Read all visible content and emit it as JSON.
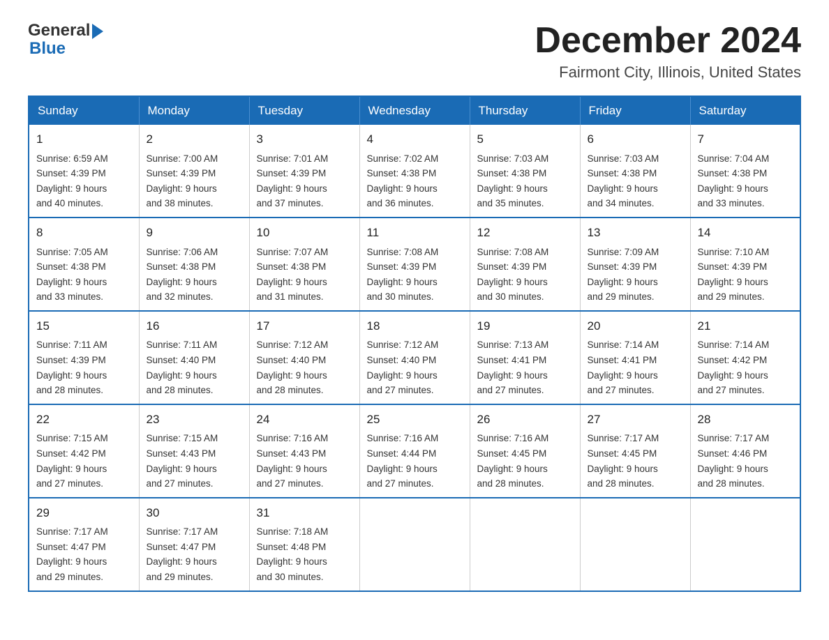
{
  "header": {
    "logo_general": "General",
    "logo_blue": "Blue",
    "month_title": "December 2024",
    "location": "Fairmont City, Illinois, United States"
  },
  "weekdays": [
    "Sunday",
    "Monday",
    "Tuesday",
    "Wednesday",
    "Thursday",
    "Friday",
    "Saturday"
  ],
  "weeks": [
    [
      {
        "day": "1",
        "sunrise": "6:59 AM",
        "sunset": "4:39 PM",
        "daylight": "9 hours and 40 minutes."
      },
      {
        "day": "2",
        "sunrise": "7:00 AM",
        "sunset": "4:39 PM",
        "daylight": "9 hours and 38 minutes."
      },
      {
        "day": "3",
        "sunrise": "7:01 AM",
        "sunset": "4:39 PM",
        "daylight": "9 hours and 37 minutes."
      },
      {
        "day": "4",
        "sunrise": "7:02 AM",
        "sunset": "4:38 PM",
        "daylight": "9 hours and 36 minutes."
      },
      {
        "day": "5",
        "sunrise": "7:03 AM",
        "sunset": "4:38 PM",
        "daylight": "9 hours and 35 minutes."
      },
      {
        "day": "6",
        "sunrise": "7:03 AM",
        "sunset": "4:38 PM",
        "daylight": "9 hours and 34 minutes."
      },
      {
        "day": "7",
        "sunrise": "7:04 AM",
        "sunset": "4:38 PM",
        "daylight": "9 hours and 33 minutes."
      }
    ],
    [
      {
        "day": "8",
        "sunrise": "7:05 AM",
        "sunset": "4:38 PM",
        "daylight": "9 hours and 33 minutes."
      },
      {
        "day": "9",
        "sunrise": "7:06 AM",
        "sunset": "4:38 PM",
        "daylight": "9 hours and 32 minutes."
      },
      {
        "day": "10",
        "sunrise": "7:07 AM",
        "sunset": "4:38 PM",
        "daylight": "9 hours and 31 minutes."
      },
      {
        "day": "11",
        "sunrise": "7:08 AM",
        "sunset": "4:39 PM",
        "daylight": "9 hours and 30 minutes."
      },
      {
        "day": "12",
        "sunrise": "7:08 AM",
        "sunset": "4:39 PM",
        "daylight": "9 hours and 30 minutes."
      },
      {
        "day": "13",
        "sunrise": "7:09 AM",
        "sunset": "4:39 PM",
        "daylight": "9 hours and 29 minutes."
      },
      {
        "day": "14",
        "sunrise": "7:10 AM",
        "sunset": "4:39 PM",
        "daylight": "9 hours and 29 minutes."
      }
    ],
    [
      {
        "day": "15",
        "sunrise": "7:11 AM",
        "sunset": "4:39 PM",
        "daylight": "9 hours and 28 minutes."
      },
      {
        "day": "16",
        "sunrise": "7:11 AM",
        "sunset": "4:40 PM",
        "daylight": "9 hours and 28 minutes."
      },
      {
        "day": "17",
        "sunrise": "7:12 AM",
        "sunset": "4:40 PM",
        "daylight": "9 hours and 28 minutes."
      },
      {
        "day": "18",
        "sunrise": "7:12 AM",
        "sunset": "4:40 PM",
        "daylight": "9 hours and 27 minutes."
      },
      {
        "day": "19",
        "sunrise": "7:13 AM",
        "sunset": "4:41 PM",
        "daylight": "9 hours and 27 minutes."
      },
      {
        "day": "20",
        "sunrise": "7:14 AM",
        "sunset": "4:41 PM",
        "daylight": "9 hours and 27 minutes."
      },
      {
        "day": "21",
        "sunrise": "7:14 AM",
        "sunset": "4:42 PM",
        "daylight": "9 hours and 27 minutes."
      }
    ],
    [
      {
        "day": "22",
        "sunrise": "7:15 AM",
        "sunset": "4:42 PM",
        "daylight": "9 hours and 27 minutes."
      },
      {
        "day": "23",
        "sunrise": "7:15 AM",
        "sunset": "4:43 PM",
        "daylight": "9 hours and 27 minutes."
      },
      {
        "day": "24",
        "sunrise": "7:16 AM",
        "sunset": "4:43 PM",
        "daylight": "9 hours and 27 minutes."
      },
      {
        "day": "25",
        "sunrise": "7:16 AM",
        "sunset": "4:44 PM",
        "daylight": "9 hours and 27 minutes."
      },
      {
        "day": "26",
        "sunrise": "7:16 AM",
        "sunset": "4:45 PM",
        "daylight": "9 hours and 28 minutes."
      },
      {
        "day": "27",
        "sunrise": "7:17 AM",
        "sunset": "4:45 PM",
        "daylight": "9 hours and 28 minutes."
      },
      {
        "day": "28",
        "sunrise": "7:17 AM",
        "sunset": "4:46 PM",
        "daylight": "9 hours and 28 minutes."
      }
    ],
    [
      {
        "day": "29",
        "sunrise": "7:17 AM",
        "sunset": "4:47 PM",
        "daylight": "9 hours and 29 minutes."
      },
      {
        "day": "30",
        "sunrise": "7:17 AM",
        "sunset": "4:47 PM",
        "daylight": "9 hours and 29 minutes."
      },
      {
        "day": "31",
        "sunrise": "7:18 AM",
        "sunset": "4:48 PM",
        "daylight": "9 hours and 30 minutes."
      },
      null,
      null,
      null,
      null
    ]
  ],
  "labels": {
    "sunrise": "Sunrise: ",
    "sunset": "Sunset: ",
    "daylight": "Daylight: "
  }
}
